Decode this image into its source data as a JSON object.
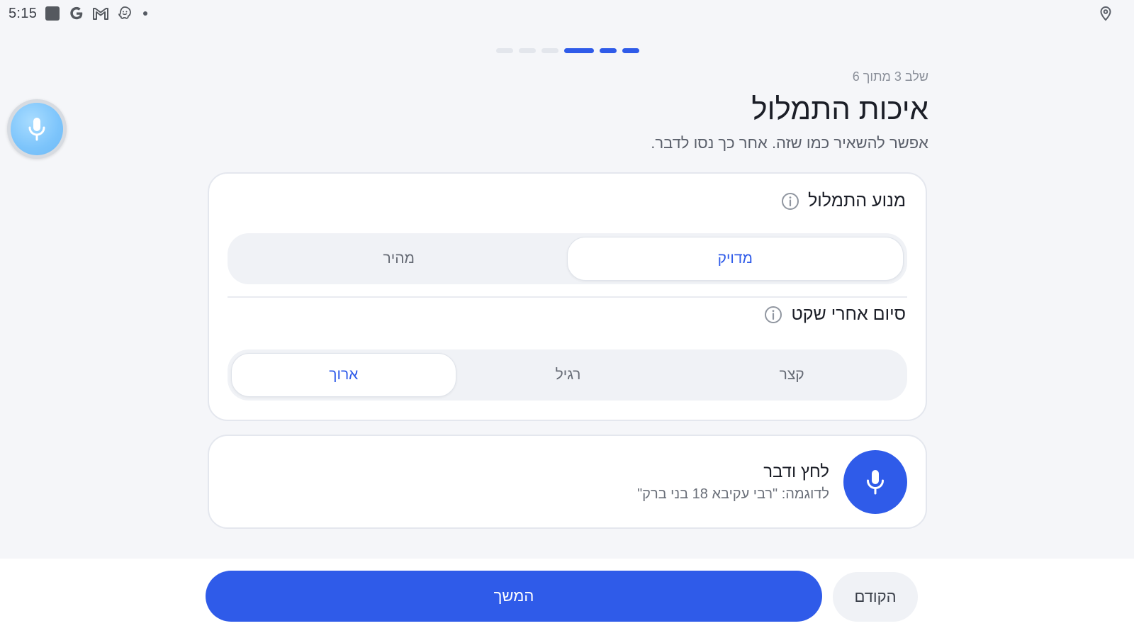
{
  "status_bar": {
    "time": "5:15",
    "icons": [
      "square-app-icon",
      "google-icon",
      "gmail-icon",
      "waze-icon",
      "notification-dot-icon"
    ],
    "right_icons": [
      "location-pin-icon"
    ]
  },
  "stepper": {
    "total_steps": 6,
    "current_step": 3,
    "colors": {
      "active": "#2f5be9",
      "inactive": "#e3e6ec"
    }
  },
  "header": {
    "step_label": "שלב 3 מתוך 6",
    "title": "איכות התמלול",
    "subtitle": "אפשר להשאיר כמו שזה. אחר כך נסו לדבר."
  },
  "engine_section": {
    "title": "מנוע התמלול",
    "options": [
      "מדויק",
      "מהיר"
    ],
    "selected": "מדויק"
  },
  "silence_section": {
    "title": "סיום אחרי שקט",
    "options": [
      "קצר",
      "רגיל",
      "ארוך"
    ],
    "selected": "ארוך"
  },
  "mic_card": {
    "title": "לחץ ודבר",
    "hint": "לדוגמה: \"רבי עקיבא 18 בני ברק\""
  },
  "footer": {
    "continue_label": "המשך",
    "back_label": "הקודם"
  },
  "colors": {
    "accent": "#2f5be9",
    "background": "#f5f6f9",
    "card": "#ffffff"
  }
}
